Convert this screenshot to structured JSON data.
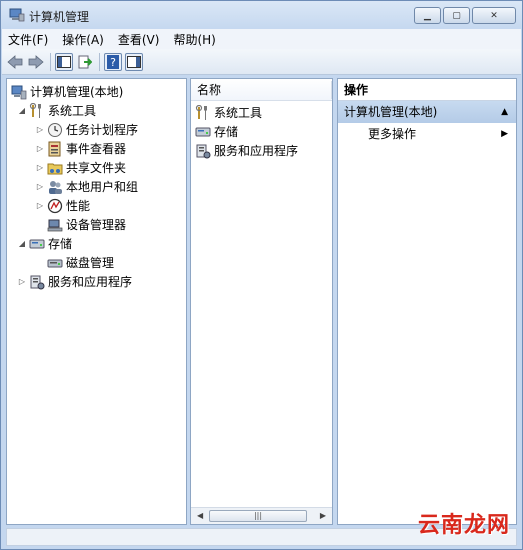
{
  "window": {
    "title": "计算机管理",
    "menu": [
      "文件(F)",
      "操作(A)",
      "查看(V)",
      "帮助(H)"
    ]
  },
  "toolbar": {
    "icons": [
      "back-arrow-icon",
      "forward-arrow-icon",
      "console-tree-icon",
      "export-list-icon",
      "help-icon",
      "show-hide-pane-icon"
    ]
  },
  "tree": {
    "root": "计算机管理(本地)",
    "system_tools": "系统工具",
    "task_scheduler": "任务计划程序",
    "event_viewer": "事件查看器",
    "shared_folders": "共享文件夹",
    "local_users": "本地用户和组",
    "performance": "性能",
    "device_manager": "设备管理器",
    "storage": "存储",
    "disk_management": "磁盘管理",
    "services_apps": "服务和应用程序"
  },
  "list": {
    "column_name": "名称",
    "items": [
      "系统工具",
      "存储",
      "服务和应用程序"
    ]
  },
  "actions": {
    "header": "操作",
    "section": "计算机管理(本地)",
    "more": "更多操作"
  },
  "watermark": "云南龙网"
}
